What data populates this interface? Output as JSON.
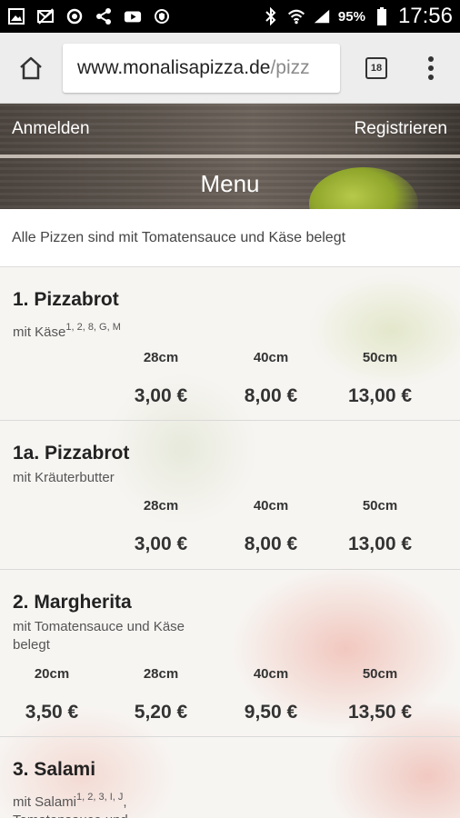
{
  "status_bar": {
    "battery_percent": "95%",
    "time": "17:56",
    "icons": [
      "gallery-icon",
      "mail-off-icon",
      "sync-icon",
      "share-icon",
      "youtube-icon",
      "shield-icon",
      "bluetooth-icon",
      "wifi-icon",
      "signal-icon",
      "battery-icon"
    ]
  },
  "browser": {
    "url_domain": "www.monalisapizza.de",
    "url_path": "/pizz",
    "tab_count": "18",
    "icons": [
      "home-icon",
      "tabs-icon",
      "overflow-menu-icon"
    ]
  },
  "site_header": {
    "login": "Anmelden",
    "register": "Registrieren",
    "title": "Menu"
  },
  "notice": "Alle Pizzen sind mit Tomatensauce und Käse belegt",
  "items": [
    {
      "title": "1. Pizzabrot",
      "desc": "mit Käse",
      "desc_sup": "1, 2, 8, G, M",
      "sizes": [
        "28cm",
        "40cm",
        "50cm"
      ],
      "prices": [
        "3,00 €",
        "8,00 €",
        "13,00 €"
      ]
    },
    {
      "title": "1a. Pizzabrot",
      "desc": "mit Kräuterbutter",
      "desc_sup": "",
      "sizes": [
        "28cm",
        "40cm",
        "50cm"
      ],
      "prices": [
        "3,00 €",
        "8,00 €",
        "13,00 €"
      ]
    },
    {
      "title": "2. Margherita",
      "desc": "mit Tomatensauce und Käse belegt",
      "desc_sup": "",
      "sizes": [
        "20cm",
        "28cm",
        "40cm",
        "50cm"
      ],
      "prices": [
        "3,50 €",
        "5,20 €",
        "9,50 €",
        "13,50 €"
      ]
    },
    {
      "title": "3. Salami",
      "desc": "mit Salami",
      "desc_sup": "1, 2, 3, I, J",
      "desc_tail": ", Tomatensauce und",
      "sizes": [],
      "prices": []
    }
  ],
  "colors": {
    "status_bar_bg": "#000000",
    "browser_bar_bg": "#ededed",
    "header_wood": "#5d554e",
    "text_dark": "#222222"
  }
}
